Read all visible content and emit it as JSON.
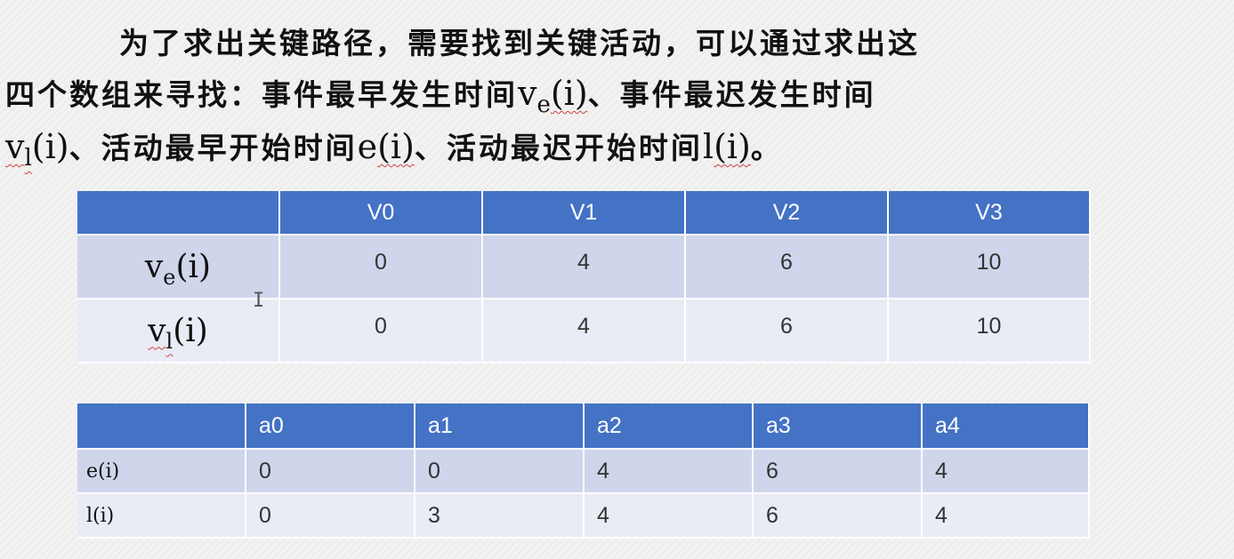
{
  "intro": {
    "line1": "为了求出关键路径，需要找到关键活动，可以通过求出这",
    "line2_a": "四个数组来寻找：事件最早发生时间",
    "line2_b": "、事件最迟发生时间",
    "line3_b": "、活动最早开始时间",
    "line3_d": "、活动最迟开始时间",
    "line3_f": "。",
    "ve_base": "v",
    "ve_sub": "e",
    "vl_base": "v",
    "vl_sub": "l",
    "arg": "(i)",
    "e_fn": "e",
    "l_fn": "l"
  },
  "vertex_table": {
    "headers": [
      "",
      "V0",
      "V1",
      "V2",
      "V3"
    ],
    "rows": [
      {
        "label_base": "v",
        "label_sub": "e",
        "label_arg": "(i)",
        "values": [
          "0",
          "4",
          "6",
          "10"
        ]
      },
      {
        "label_base": "v",
        "label_sub": "l",
        "label_arg": "(i)",
        "values": [
          "0",
          "4",
          "6",
          "10"
        ]
      }
    ]
  },
  "activity_table": {
    "headers": [
      "",
      "a0",
      "a1",
      "a2",
      "a3",
      "a4"
    ],
    "rows": [
      {
        "label": "e(i)",
        "values": [
          "0",
          "0",
          "4",
          "6",
          "4"
        ]
      },
      {
        "label": "l(i)",
        "values": [
          "0",
          "3",
          "4",
          "6",
          "4"
        ]
      }
    ]
  },
  "cursor": {
    "icon": "text-cursor-icon",
    "glyph": "I"
  },
  "colors": {
    "header_bg": "#4472c4",
    "row_dark": "#cfd5ea",
    "row_light": "#e9ebf5"
  }
}
